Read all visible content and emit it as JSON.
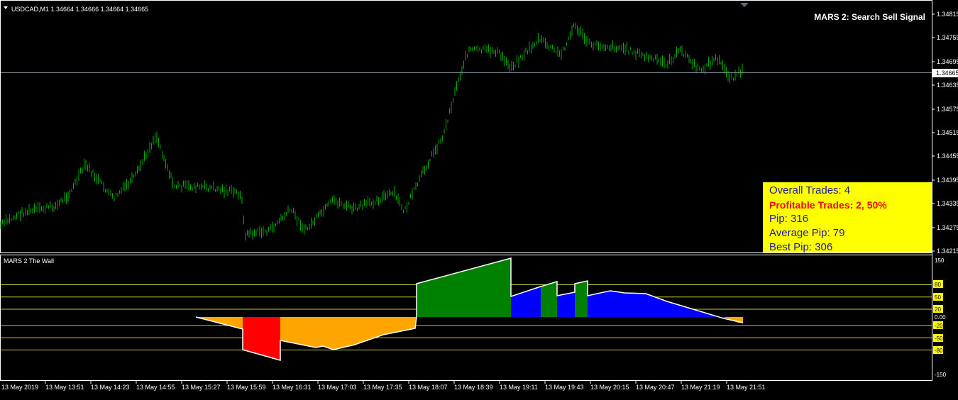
{
  "main_chart": {
    "symbol_header": "USDCAD,M1  1.34664 1.34666 1.34664 1.34665",
    "indicator_title": "MARS 2: Search Sell Signal",
    "price_axis_ticks": [
      "1.34815",
      "1.34755",
      "1.34695",
      "1.34665",
      "1.34635",
      "1.34575",
      "1.34515",
      "1.34455",
      "1.34395",
      "1.34335",
      "1.34275",
      "1.34215"
    ],
    "current_price": "1.34665",
    "colors": {
      "bars": "#00aa00",
      "price_line": "#778899",
      "current_label_bg": "#ffffff"
    }
  },
  "info_panel": {
    "overall_trades": "Overall Trades: 4",
    "profitable_trades": "Profitable Trades: 2, 50%",
    "pip": "Pip: 316",
    "average_pip": "Average Pip: 79",
    "best_pip": "Best Pip: 306",
    "colors": {
      "background": "#ffff00",
      "text": "#1a1aa0",
      "highlight": "#ff0000"
    }
  },
  "sub_window": {
    "title": "MARS 2 The Wall",
    "axis_labels": [
      "150",
      "80",
      "50",
      "20",
      "0.00",
      "-20",
      "-50",
      "-80",
      "-150"
    ],
    "level_lines": [
      80,
      50,
      20,
      -20,
      -50,
      -80
    ],
    "colors": {
      "orange": "#ffa500",
      "red": "#ff0000",
      "green": "#008000",
      "blue": "#0000ff",
      "levels": "#c8c832"
    }
  },
  "time_axis": {
    "labels": [
      "13 May 2019",
      "13 May 13:51",
      "13 May 14:23",
      "13 May 14:55",
      "13 May 15:27",
      "13 May 15:59",
      "13 May 16:31",
      "13 May 17:03",
      "13 May 17:35",
      "13 May 18:07",
      "13 May 18:39",
      "13 May 19:11",
      "13 May 19:43",
      "13 May 20:15",
      "13 May 20:47",
      "13 May 21:19",
      "13 May 21:51"
    ]
  },
  "chart_data": [
    {
      "type": "ohlc",
      "title": "USDCAD,M1",
      "ylim": [
        1.3421,
        1.3482
      ],
      "series": [
        {
          "name": "USDCAD,M1",
          "x": [
            "13 May 2019",
            "13 May 13:51",
            "13 May 14:23",
            "13 May 14:55",
            "13 May 15:27",
            "13 May 15:59",
            "13 May 16:31",
            "13 May 17:03",
            "13 May 17:35",
            "13 May 18:07",
            "13 May 18:39",
            "13 May 19:11",
            "13 May 19:43",
            "13 May 20:15",
            "13 May 20:47",
            "13 May 21:19",
            "13 May 21:51"
          ],
          "values": [
            1.3427,
            1.3431,
            1.3435,
            1.3447,
            1.3434,
            1.3424,
            1.3429,
            1.3433,
            1.3432,
            1.3446,
            1.3469,
            1.347,
            1.3476,
            1.3471,
            1.3469,
            1.3467,
            1.3467
          ]
        }
      ],
      "current_price": 1.34665
    },
    {
      "type": "area",
      "title": "MARS 2 The Wall",
      "ylim": [
        -150,
        150
      ],
      "levels": [
        80,
        50,
        20,
        -20,
        -50,
        -80
      ],
      "series": [
        {
          "color": "orange",
          "x": [
            "13 May 15:27",
            "13 May 15:59",
            "13 May 16:31",
            "13 May 17:03",
            "13 May 17:35",
            "13 May 18:07"
          ],
          "values": [
            0,
            -20,
            -50,
            -50,
            -35,
            -20
          ]
        },
        {
          "color": "red",
          "x": [
            "13 May 15:59",
            "13 May 16:31"
          ],
          "values": [
            -80,
            -105
          ]
        },
        {
          "color": "green",
          "x": [
            "13 May 18:07",
            "13 May 18:39",
            "13 May 19:11"
          ],
          "values": [
            80,
            120,
            150
          ]
        },
        {
          "color": "blue",
          "x": [
            "13 May 19:11",
            "13 May 19:43",
            "13 May 20:15",
            "13 May 20:47",
            "13 May 21:19",
            "13 May 21:51"
          ],
          "values": [
            50,
            60,
            60,
            50,
            25,
            -10
          ]
        }
      ]
    }
  ]
}
